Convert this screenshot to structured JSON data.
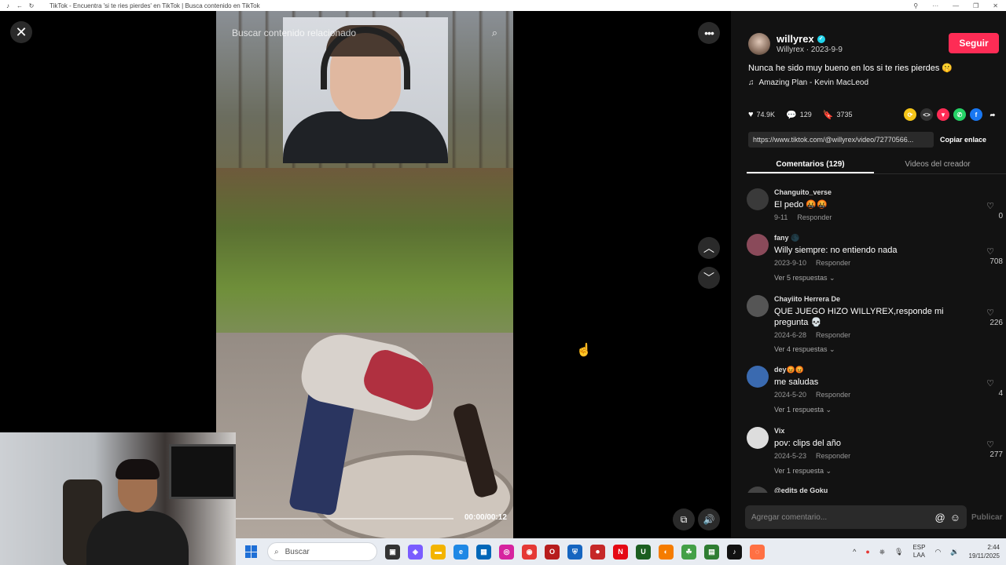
{
  "browser": {
    "tab_title": "TikTok - Encuentra 'si te ries pierdes' en TikTok | Busca contenido en TikTok"
  },
  "video": {
    "search_placeholder": "Buscar contenido relacionado",
    "time": "00:00/00:12",
    "progress_fraction": 0.0
  },
  "post": {
    "author_name": "willyrex",
    "author_sub": "Willyrex · 2023-9-9",
    "follow_label": "Seguir",
    "description": "Nunca he sido muy bueno en los si te ries pierdes 🤫",
    "music": "Amazing Plan - Kevin MacLeod",
    "likes": "74.9K",
    "comments": "129",
    "saves": "3735",
    "link": "https://www.tiktok.com/@willyrex/video/72770566...",
    "copy_label": "Copiar enlace"
  },
  "tabs": [
    {
      "label": "Comentarios (129)",
      "active": true
    },
    {
      "label": "Videos del creador",
      "active": false
    }
  ],
  "comments": [
    {
      "user": "Changuito_verse",
      "text": "El pedo 🤬🤬",
      "date": "9-11",
      "reply": "Responder",
      "likes": "0",
      "replies": ""
    },
    {
      "user": "fany 🌑",
      "text": "Willy siempre: no entiendo nada",
      "date": "2023-9-10",
      "reply": "Responder",
      "likes": "708",
      "replies": "Ver 5 respuestas"
    },
    {
      "user": "Chayiito Herrera De",
      "text": "QUE JUEGO HIZO WILLYREX,responde mi pregunta 💀",
      "date": "2024-6-28",
      "reply": "Responder",
      "likes": "226",
      "replies": "Ver 4 respuestas"
    },
    {
      "user": "dey😡😡",
      "text": "me saludas",
      "date": "2024-5-20",
      "reply": "Responder",
      "likes": "4",
      "replies": "Ver 1 respuesta"
    },
    {
      "user": "Vix",
      "text": "pov: clips del año",
      "date": "2024-5-23",
      "reply": "Responder",
      "likes": "277",
      "replies": "Ver 1 respuesta"
    },
    {
      "user": "@edits de Goku",
      "text": "",
      "date": "",
      "reply": "",
      "likes": "",
      "replies": ""
    }
  ],
  "comment_input": {
    "placeholder": "Agregar comentario...",
    "publish_label": "Publicar"
  },
  "taskbar": {
    "search_label": "Buscar",
    "lang_top": "ESP",
    "lang_bottom": "LAA",
    "time": "2:44",
    "date": "19/11/2025"
  },
  "colors": {
    "follow": "#fe2c55",
    "panel_bg": "#121212",
    "verified": "#20d5ec"
  }
}
